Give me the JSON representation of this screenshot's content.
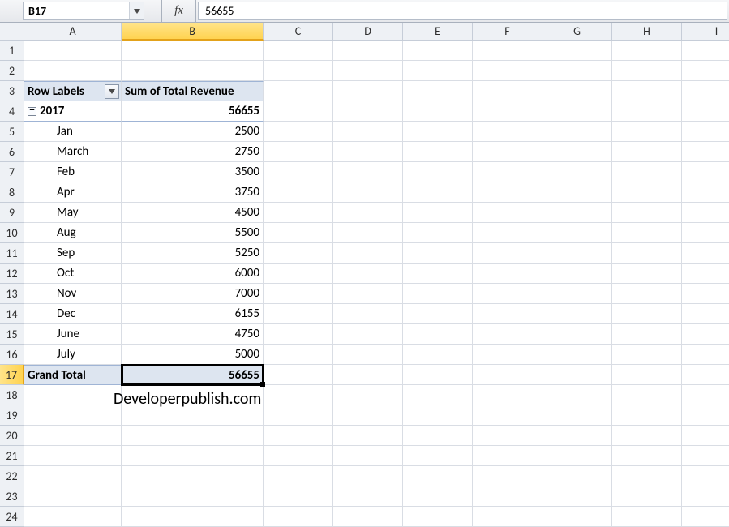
{
  "formula_bar": {
    "cell_ref": "B17",
    "fx_label": "fx",
    "value": "56655"
  },
  "columns": [
    "A",
    "B",
    "C",
    "D",
    "E",
    "F",
    "G",
    "H",
    "I"
  ],
  "row_count": 24,
  "selected_col_index": 1,
  "selected_row_index": 16,
  "pivot": {
    "header_row_labels": "Row Labels",
    "header_sum": "Sum of Total Revenue",
    "year_label": "2017",
    "year_total": "56655",
    "months": [
      {
        "label": "Jan",
        "value": "2500"
      },
      {
        "label": "March",
        "value": "2750"
      },
      {
        "label": "Feb",
        "value": "3500"
      },
      {
        "label": "Apr",
        "value": "3750"
      },
      {
        "label": "May",
        "value": "4500"
      },
      {
        "label": "Aug",
        "value": "5500"
      },
      {
        "label": "Sep",
        "value": "5250"
      },
      {
        "label": "Oct",
        "value": "6000"
      },
      {
        "label": "Nov",
        "value": "7000"
      },
      {
        "label": "Dec",
        "value": "6155"
      },
      {
        "label": "June",
        "value": "4750"
      },
      {
        "label": "July",
        "value": "5000"
      }
    ],
    "grand_total_label": "Grand Total",
    "grand_total_value": "56655"
  },
  "watermark": "Developerpublish.com",
  "chart_data": {
    "type": "table",
    "title": "Sum of Total Revenue",
    "categories": [
      "Jan",
      "March",
      "Feb",
      "Apr",
      "May",
      "Aug",
      "Sep",
      "Oct",
      "Nov",
      "Dec",
      "June",
      "July"
    ],
    "values": [
      2500,
      2750,
      3500,
      3750,
      4500,
      5500,
      5250,
      6000,
      7000,
      6155,
      4750,
      5000
    ],
    "year": 2017,
    "grand_total": 56655
  }
}
